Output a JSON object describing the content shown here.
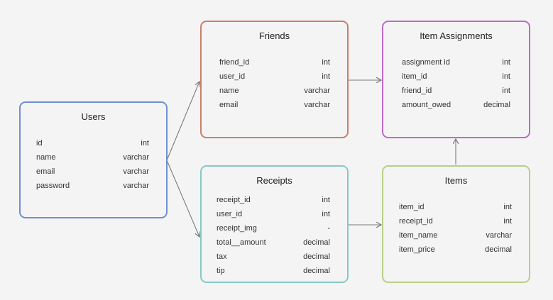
{
  "entities": {
    "users": {
      "title": "Users",
      "fields": [
        {
          "name": "id",
          "type": "int"
        },
        {
          "name": "name",
          "type": "varchar"
        },
        {
          "name": "email",
          "type": "varchar"
        },
        {
          "name": "password",
          "type": "varchar"
        }
      ]
    },
    "friends": {
      "title": "Friends",
      "fields": [
        {
          "name": "friend_id",
          "type": "int"
        },
        {
          "name": "user_id",
          "type": "int"
        },
        {
          "name": "name",
          "type": "varchar"
        },
        {
          "name": "email",
          "type": "varchar"
        }
      ]
    },
    "receipts": {
      "title": "Receipts",
      "fields": [
        {
          "name": "receipt_id",
          "type": "int"
        },
        {
          "name": "user_id",
          "type": "int"
        },
        {
          "name": "receipt_img",
          "type": "-"
        },
        {
          "name": "total__amount",
          "type": "decimal"
        },
        {
          "name": "tax",
          "type": "decimal"
        },
        {
          "name": "tip",
          "type": "decimal"
        }
      ]
    },
    "item_assignments": {
      "title": "Item Assignments",
      "fields": [
        {
          "name": "assignment id",
          "type": "int"
        },
        {
          "name": "item_id",
          "type": "int"
        },
        {
          "name": "friend_id",
          "type": "int"
        },
        {
          "name": "amount_owed",
          "type": "decimal"
        }
      ]
    },
    "items": {
      "title": "Items",
      "fields": [
        {
          "name": "item_id",
          "type": "int"
        },
        {
          "name": "receipt_id",
          "type": "int"
        },
        {
          "name": "item_name",
          "type": "varchar"
        },
        {
          "name": "item_price",
          "type": "decimal"
        }
      ]
    }
  },
  "colors": {
    "users": "#6f8fd1",
    "friends": "#c98068",
    "receipts": "#86c9c5",
    "item_assignments": "#c06ac6",
    "items": "#b7cf86",
    "connector": "#7a7a7a"
  }
}
